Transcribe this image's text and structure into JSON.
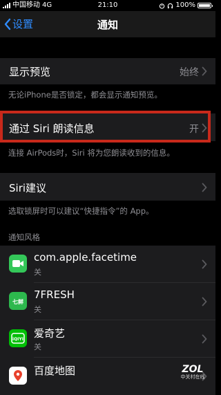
{
  "status_bar": {
    "carrier": "中国移动",
    "network": "4G",
    "time": "21:10",
    "battery_percent": "100%",
    "battery_level": 1.0
  },
  "nav": {
    "back_label": "设置",
    "title": "通知"
  },
  "show_preview": {
    "label": "显示预览",
    "value": "始终",
    "footer": "无论iPhone是否锁定，都会显示通知预览。"
  },
  "siri_announce": {
    "label": "通过 Siri 朗读信息",
    "value": "开",
    "footer": "连接 AirPods时，Siri 将为您朗读收到的信息。"
  },
  "siri_suggestions": {
    "label": "Siri建议",
    "footer": "选取锁屏时可以建议“快捷指令”的 App。"
  },
  "notification_style": {
    "header": "通知风格",
    "apps": [
      {
        "name": "com.apple.facetime",
        "status": "关",
        "icon": "facetime-icon",
        "color": "#34c759"
      },
      {
        "name": "7FRESH",
        "status": "关",
        "icon": "7fresh-icon",
        "color": "#2db84d",
        "icon_text": "七鲜"
      },
      {
        "name": "爱奇艺",
        "status": "关",
        "icon": "iqiyi-icon",
        "color": "#00be06",
        "icon_text": "iQIYI"
      },
      {
        "name": "百度地图",
        "status": "",
        "icon": "baidu-map-icon",
        "color": "#ffffff"
      }
    ]
  },
  "watermark": {
    "logo": "ZOL",
    "sub": "中关村在线"
  },
  "colors": {
    "accent": "#2f8cff",
    "highlight_border": "#c8291b",
    "cell_bg": "#1c1c1e"
  }
}
